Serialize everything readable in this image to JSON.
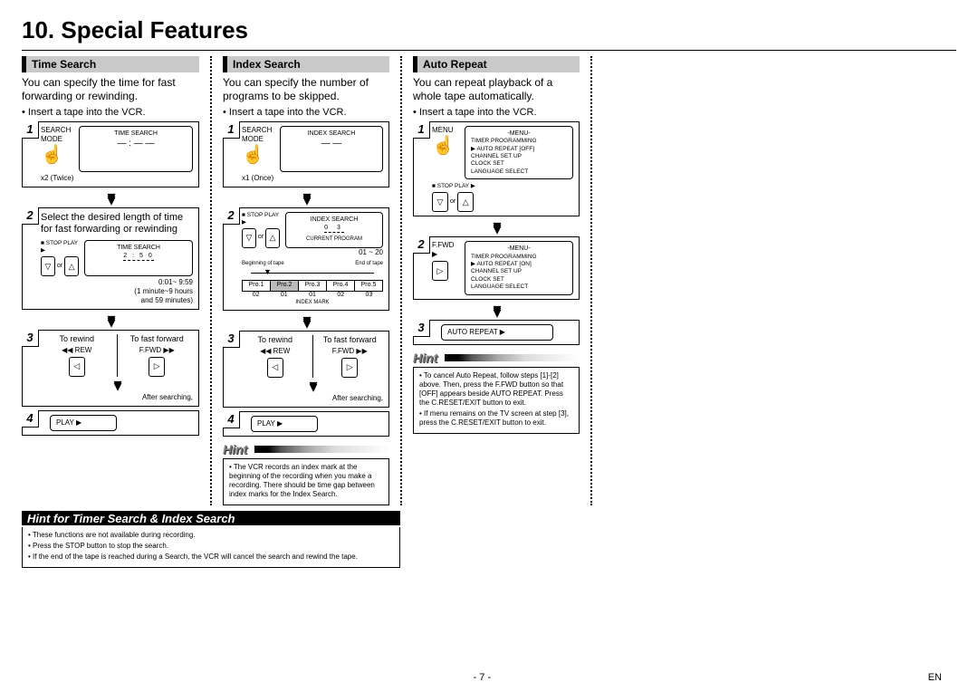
{
  "title": "10. Special Features",
  "columns": {
    "time": {
      "heading": "Time Search",
      "intro": "You can specify the time for fast forwarding or rewinding.",
      "bullet": "Insert a tape into the VCR.",
      "s1_screen": "TIME SEARCH",
      "s1_label": "SEARCH MODE",
      "s1_note": "x2 (Twice)",
      "s2_text": "Select the desired length of time for fast forwarding or rewinding",
      "s2_screen": "TIME SEARCH",
      "s2_time": "2 : 5 0",
      "s2_sp": "■ STOP   PLAY ▶",
      "s2_range": "0:01~ 9:59\n(1 minute~9 hours\nand 59 minutes)",
      "s3_l": "To rewind",
      "s3_r": "To fast forward",
      "s3_rew": "◀◀ REW",
      "s3_fwd": "F.FWD ▶▶",
      "s3_after": "After searching,",
      "s4_play": "PLAY ▶"
    },
    "index": {
      "heading": "Index Search",
      "intro": "You can specify the number of programs to be skipped.",
      "bullet": "Insert a tape into the VCR.",
      "s1_screen": "INDEX SEARCH",
      "s1_label": "SEARCH MODE",
      "s1_note": "x1 (Once)",
      "s2_screen": "INDEX SEARCH",
      "s2_val": "0 3",
      "s2_cp": "CURRENT PROGRAM",
      "s2_sp": "■ STOP   PLAY ▶",
      "s2_range": "01 ~ 20",
      "s2_bot": "Beginning of tape",
      "s2_eot": "End of tape",
      "pro": [
        "Pro.1",
        "Pro.2",
        "Pro.3",
        "Pro.4",
        "Pro.5"
      ],
      "pro_n": [
        "02",
        "01",
        "01",
        "02",
        "03"
      ],
      "s2_im": "INDEX MARK",
      "s3_l": "To rewind",
      "s3_r": "To fast forward",
      "s3_rew": "◀◀ REW",
      "s3_fwd": "F.FWD ▶▶",
      "s3_after": "After searching,",
      "s4_play": "PLAY ▶",
      "hint_title": "Hint",
      "hint_body": "The VCR records an index mark at the beginning of the recording when you make a recording. There should be time gap between index marks for the Index Search."
    },
    "repeat": {
      "heading": "Auto Repeat",
      "intro": "You can repeat playback of a whole tape automatically.",
      "bullet": "Insert a tape into the VCR.",
      "s1_menu_btn": "MENU",
      "menu_title": "-MENU-",
      "menu1": [
        "TIMER PROGRAMMING",
        "▶ AUTO REPEAT  [OFF]",
        "CHANNEL SET UP",
        "CLOCK SET",
        "LANGUAGE SELECT"
      ],
      "s1_sp": "■ STOP   PLAY ▶",
      "s2_btn": "F.FWD ▶",
      "menu2": [
        "TIMER PROGRAMMING",
        "▶ AUTO REPEAT  [ON]",
        "CHANNEL SET UP",
        "CLOCK SET",
        "LANGUAGE SELECT"
      ],
      "s3_txt": "AUTO REPEAT ▶",
      "hint_title": "Hint",
      "hint1": "To cancel Auto Repeat, follow steps [1]-[2] above. Then, press the F.FWD button so that [OFF] appears beside AUTO REPEAT. Press the C.RESET/EXIT button to exit.",
      "hint2": "If menu remains on the TV screen at step [3], press the C.RESET/EXIT button to exit."
    }
  },
  "hint2": {
    "title": "Hint for Timer Search & Index Search",
    "l1": "These functions are not available during recording.",
    "l2": "Press the STOP button to stop the search.",
    "l3": "If the end of the tape is reached during a Search, the VCR will cancel the search and rewind the tape."
  },
  "footer": {
    "page": "- 7 -",
    "lang": "EN"
  }
}
